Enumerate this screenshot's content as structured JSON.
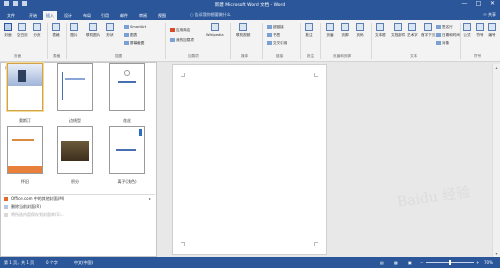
{
  "titlebar": {
    "title": "新建 Microsoft Word 文档 - Word",
    "close": "✕",
    "max": "□",
    "min": "—"
  },
  "tabs": [
    {
      "label": "文件",
      "active": false
    },
    {
      "label": "开始",
      "active": false
    },
    {
      "label": "插入",
      "active": true
    },
    {
      "label": "设计",
      "active": false
    },
    {
      "label": "布局",
      "active": false
    },
    {
      "label": "引用",
      "active": false
    },
    {
      "label": "邮件",
      "active": false
    },
    {
      "label": "审阅",
      "active": false
    },
    {
      "label": "视图",
      "active": false
    }
  ],
  "tellme": "告诉我你想要做什么",
  "share": "共享",
  "ribbon": {
    "big": [
      "封面",
      "空白页",
      "分页",
      "表格",
      "图片",
      "联机图片",
      "形状"
    ],
    "small_a": [
      "SmartArt",
      "图表",
      "屏幕截图"
    ],
    "small_b": [
      "应用商店",
      "我的加载项"
    ],
    "wiki": "Wikipedia",
    "video": "联机视频",
    "small_link": [
      "超链接",
      "书签",
      "交叉引用"
    ],
    "comment": "批注",
    "hf": [
      "页眉",
      "页脚",
      "页码"
    ],
    "text": [
      "文本框",
      "文档部件",
      "艺术字",
      "首字下沉"
    ],
    "small_text": [
      "签名行",
      "日期和时间",
      "对象"
    ],
    "symbols": [
      "公式",
      "符号",
      "编号"
    ],
    "groups": [
      "页面",
      "表格",
      "插图",
      "加载项",
      "媒体",
      "链接",
      "批注",
      "页眉和页脚",
      "文本",
      "符号"
    ]
  },
  "gallery": {
    "header": "内置",
    "captions": [
      "奥斯汀",
      "边线型",
      "花丝",
      "怀旧",
      "积分",
      "离子(浅色)"
    ],
    "menu": [
      {
        "label": "Office.com 中的其他封面(M)",
        "disabled": false
      },
      {
        "label": "删除当前封面(R)",
        "disabled": false
      },
      {
        "label": "将所选内容保存到封面库(S)...",
        "disabled": true
      }
    ]
  },
  "status": {
    "page": "第 1 页，共 1 页",
    "words": "0 个字",
    "lang": "中文(中国)",
    "zoom": "70%",
    "zoom_level": 0.5
  },
  "watermark": "Baidu 经验",
  "colors": {
    "accent": "#2b579a",
    "ribbon_bg": "#f3f3f3",
    "doc_bg": "#e8e8e8"
  }
}
